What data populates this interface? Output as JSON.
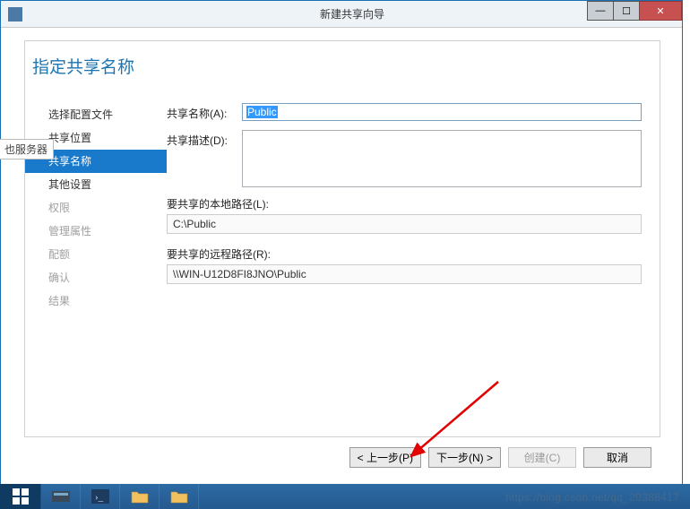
{
  "titlebar": {
    "title": "新建共享向导"
  },
  "page": {
    "heading": "指定共享名称"
  },
  "sidebar": {
    "items": [
      {
        "label": "选择配置文件",
        "state": "normal"
      },
      {
        "label": "共享位置",
        "state": "normal"
      },
      {
        "label": "共享名称",
        "state": "active"
      },
      {
        "label": "其他设置",
        "state": "normal"
      },
      {
        "label": "权限",
        "state": "disabled"
      },
      {
        "label": "管理属性",
        "state": "disabled"
      },
      {
        "label": "配额",
        "state": "disabled"
      },
      {
        "label": "确认",
        "state": "disabled"
      },
      {
        "label": "结果",
        "state": "disabled"
      }
    ]
  },
  "form": {
    "share_name_label": "共享名称(A):",
    "share_name_value": "Public",
    "share_desc_label": "共享描述(D):",
    "share_desc_value": "",
    "local_path_label": "要共享的本地路径(L):",
    "local_path_value": "C:\\Public",
    "remote_path_label": "要共享的远程路径(R):",
    "remote_path_value": "\\\\WIN-U12D8FI8JNO\\Public"
  },
  "buttons": {
    "prev": "< 上一步(P)",
    "next": "下一步(N) >",
    "create": "创建(C)",
    "cancel": "取消"
  },
  "tooltip": {
    "text": "也服务器"
  },
  "watermark": "https://blog.csdn.net/qq_20388417"
}
